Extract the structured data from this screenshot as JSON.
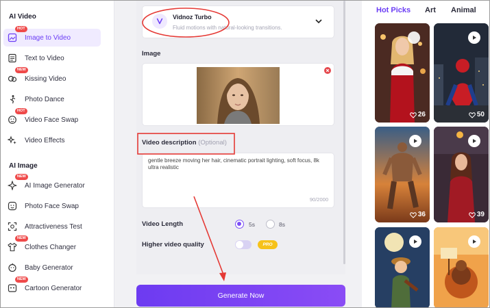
{
  "sidebar": {
    "sections": [
      {
        "title": "AI Video"
      },
      {
        "title": "AI Image"
      }
    ],
    "items": [
      {
        "label": "Image to Video",
        "badge": "HOT",
        "icon": "image-video-icon",
        "active": true
      },
      {
        "label": "Text to Video",
        "badge": "",
        "icon": "text-video-icon"
      },
      {
        "label": "Kissing Video",
        "badge": "NEW",
        "icon": "kiss-icon"
      },
      {
        "label": "Photo Dance",
        "badge": "",
        "icon": "dance-icon"
      },
      {
        "label": "Video Face Swap",
        "badge": "HOT",
        "icon": "face-swap-icon"
      },
      {
        "label": "Video Effects",
        "badge": "",
        "icon": "sparkle-icon"
      },
      {
        "label": "AI Image Generator",
        "badge": "NEW",
        "icon": "magic-icon"
      },
      {
        "label": "Photo Face Swap",
        "badge": "",
        "icon": "face-icon"
      },
      {
        "label": "Attractiveness Test",
        "badge": "",
        "icon": "scan-icon"
      },
      {
        "label": "Clothes Changer",
        "badge": "NEW",
        "icon": "shirt-icon"
      },
      {
        "label": "Baby Generator",
        "badge": "",
        "icon": "baby-icon"
      },
      {
        "label": "Cartoon Generator",
        "badge": "NEW",
        "icon": "cartoon-icon"
      }
    ]
  },
  "main": {
    "model": {
      "name": "Vidnoz Turbo",
      "description": "Fluid motions with natural-looking transitions."
    },
    "image_label": "Image",
    "description_label": "Video description",
    "description_optional": "(Optional)",
    "description_text": "gentle breeze moving her hair, cinematic portrait lighting, soft focus, 8k ultra realistic",
    "char_count": "90/2000",
    "length_label": "Video Length",
    "length_options": [
      "5s",
      "8s"
    ],
    "length_selected": "5s",
    "quality_label": "Higher video quality",
    "pro_badge": "PRO",
    "generate_label": "Generate Now"
  },
  "right": {
    "tabs": [
      "Hot Picks",
      "Art",
      "Animal"
    ],
    "active_tab": "Hot Picks",
    "thumbnails": [
      {
        "likes": "26",
        "scene": "woman-in-red-santa-dress"
      },
      {
        "likes": "50",
        "scene": "spider-hero-in-city"
      },
      {
        "likes": "36",
        "scene": "muscular-warrior-running"
      },
      {
        "likes": "39",
        "scene": "woman-in-red-dress-lantern"
      },
      {
        "likes": "",
        "scene": "boy-playing-violin-moon"
      },
      {
        "likes": "",
        "scene": "turkey-with-happy-thanksgiving-sign"
      }
    ]
  },
  "colors": {
    "accent": "#6b3df5",
    "annotation": "#e53935",
    "pro": "#f6c21a"
  }
}
